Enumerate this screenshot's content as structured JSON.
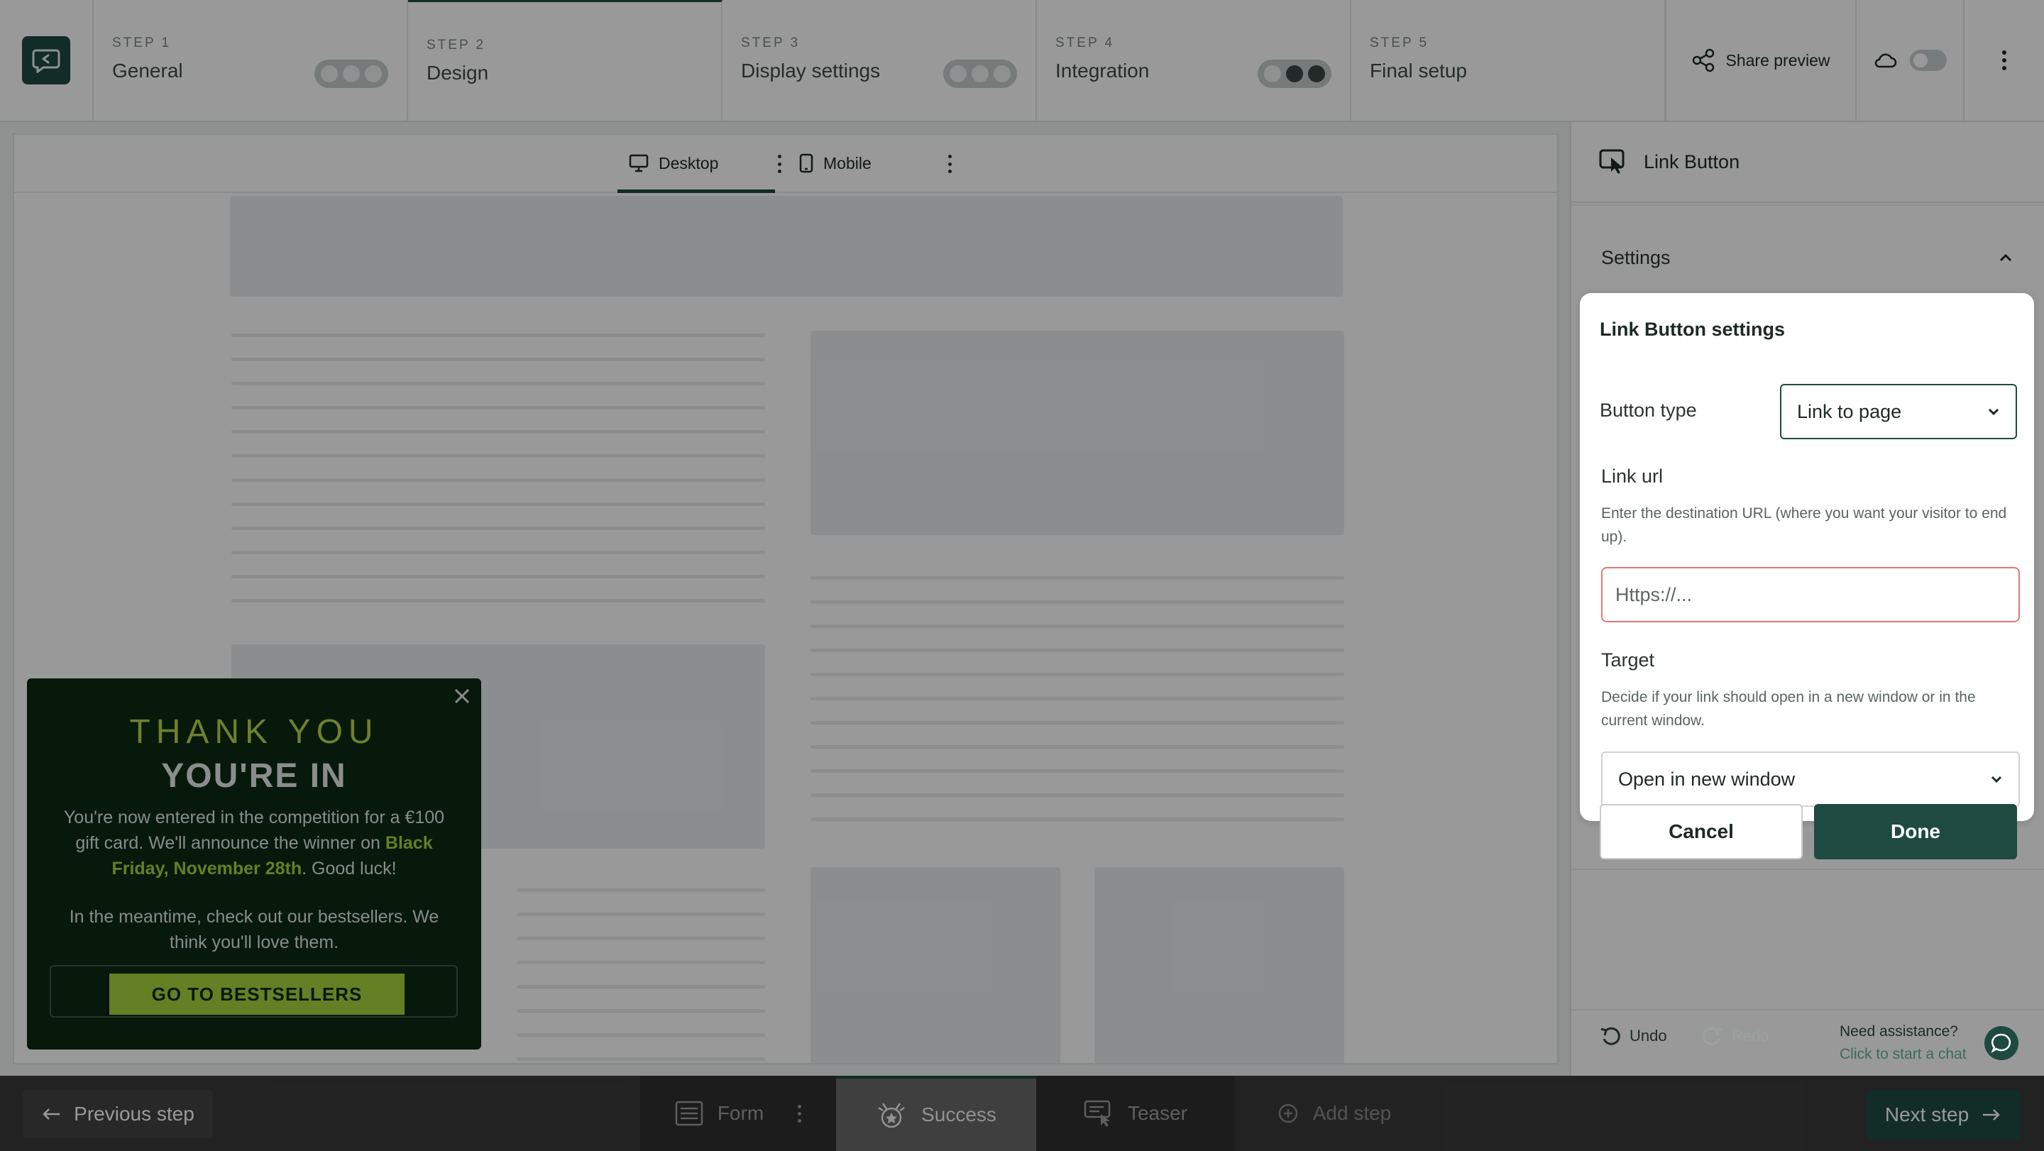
{
  "topbar": {
    "steps": [
      {
        "num": "STEP 1",
        "title": "General"
      },
      {
        "num": "STEP 2",
        "title": "Design"
      },
      {
        "num": "STEP 3",
        "title": "Display settings"
      },
      {
        "num": "STEP 4",
        "title": "Integration"
      },
      {
        "num": "STEP 5",
        "title": "Final setup"
      }
    ],
    "share_label": "Share preview"
  },
  "canvas": {
    "tabs": [
      {
        "label": "Desktop"
      },
      {
        "label": "Mobile"
      }
    ]
  },
  "popup": {
    "heading": "THANK YOU",
    "subheading": "YOU'RE IN",
    "text_1a": "You're now entered in the competition for a €100 gift card. We'll announce the winner on ",
    "text_1b": "Black Friday, November 28th",
    "text_1c": ". Good luck!",
    "text_2": "In the meantime, check out our bestsellers. We think you'll love them.",
    "cta_label": "GO TO BESTSELLERS"
  },
  "panel": {
    "title": "Link Button",
    "section": "Settings",
    "card_title": "Link Button settings",
    "button_type_label": "Button type",
    "button_type_value": "Link to page",
    "link_url_label": "Link url",
    "link_url_help": "Enter the destination URL (where you want your visitor to end up).",
    "link_url_placeholder": "Https://...",
    "target_label": "Target",
    "target_help": "Decide if your link should open in a new window or in the current window.",
    "target_value": "Open in new window",
    "cancel_label": "Cancel",
    "done_label": "Done",
    "undo_label": "Undo",
    "redo_label": "Redo",
    "assist_title": "Need assistance?",
    "assist_sub": "Click to start a chat"
  },
  "bottombar": {
    "prev_label": "Previous step",
    "steps": [
      {
        "label": "Form"
      },
      {
        "label": "Success"
      },
      {
        "label": "Teaser"
      },
      {
        "label": "Add step"
      }
    ],
    "next_label": "Next step"
  },
  "colors": {
    "brand": "#1f4a41",
    "popup_bg": "#0d2a13",
    "popup_accent": "#a8d63d",
    "error_border": "#e27a72"
  }
}
